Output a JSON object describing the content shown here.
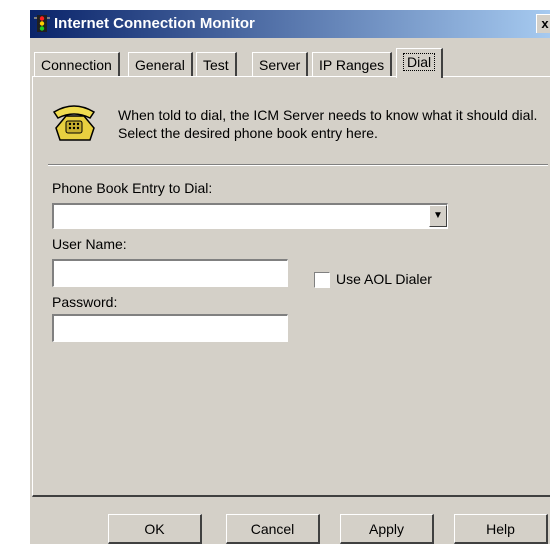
{
  "window": {
    "title": "Internet Connection Monitor",
    "close_glyph": "x"
  },
  "tabs": [
    {
      "label": "Connection",
      "active": false
    },
    {
      "label": "General",
      "active": false
    },
    {
      "label": "Test",
      "active": false
    },
    {
      "label": "Server",
      "active": false
    },
    {
      "label": "IP Ranges",
      "active": false
    },
    {
      "label": "Dial",
      "active": true
    }
  ],
  "intro": {
    "icon": "telephone-icon",
    "text": "When told to dial, the ICM Server needs to know what it should dial.  Select the desired phone book entry here."
  },
  "form": {
    "phonebook_label": "Phone Book Entry to Dial:",
    "phonebook_value": "",
    "username_label": "User Name:",
    "username_value": "",
    "password_label": "Password:",
    "password_value": "",
    "aol_label": "Use AOL Dialer",
    "aol_checked": false
  },
  "buttons": {
    "ok": "OK",
    "cancel": "Cancel",
    "apply": "Apply",
    "help": "Help"
  },
  "colors": {
    "face": "#d4d0c8",
    "title_start": "#0a246a",
    "title_end": "#a6caf0"
  }
}
